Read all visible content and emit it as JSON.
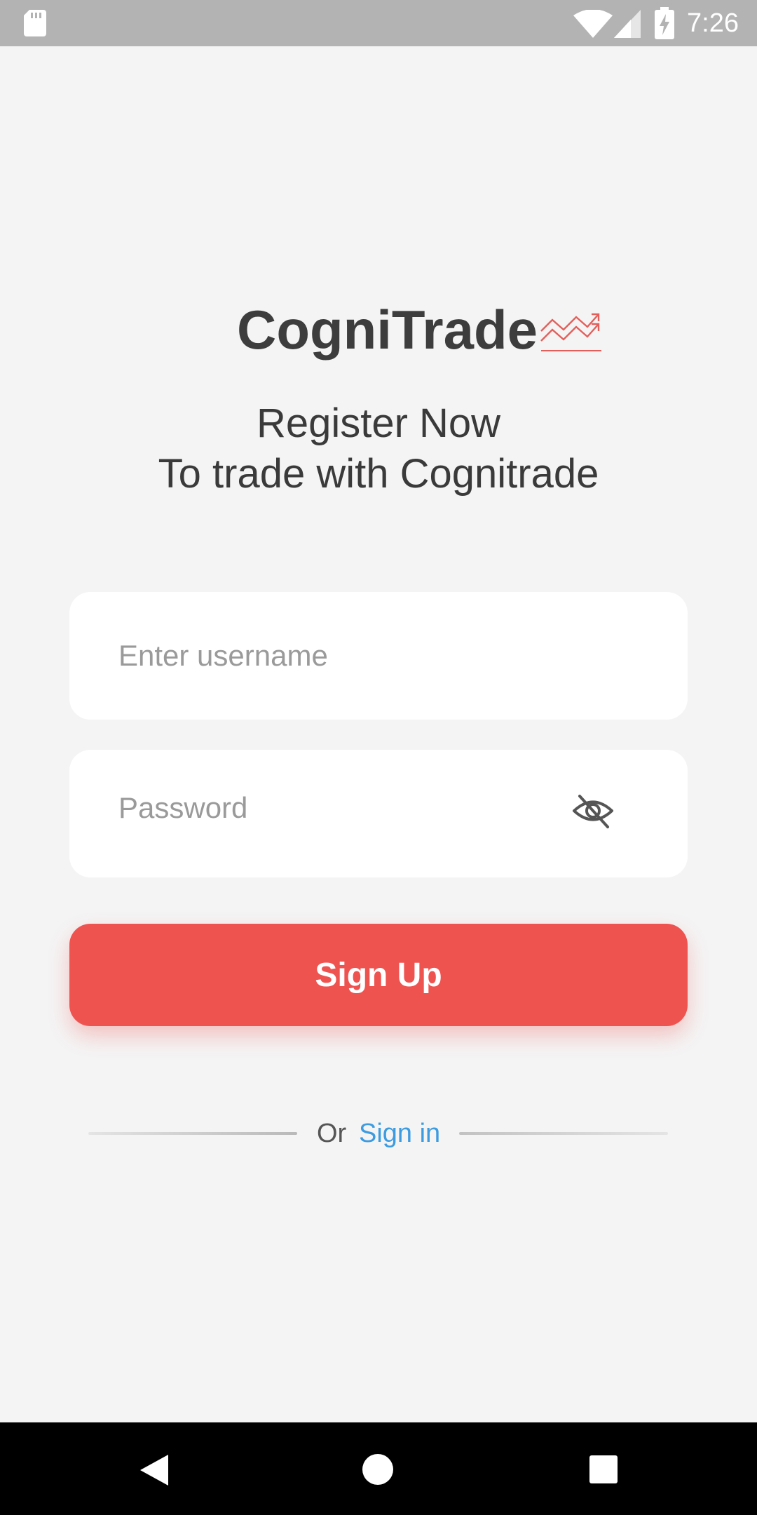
{
  "status_bar": {
    "time": "7:26",
    "icons": [
      "sd-card-icon",
      "wifi-icon",
      "signal-icon",
      "battery-charging-icon"
    ]
  },
  "brand": {
    "name": "CogniTrade",
    "icon": "trending-up-chart-icon",
    "accent_color": "#ef5350"
  },
  "tagline": {
    "line1": "Register Now",
    "line2": "To trade with Cognitrade"
  },
  "form": {
    "username_placeholder": "Enter username",
    "username_value": "",
    "password_placeholder": "Password",
    "password_value": "",
    "password_toggle_icon": "eye-off-icon",
    "submit_label": "Sign Up"
  },
  "alt_action": {
    "or_text": "Or",
    "signin_label": "Sign in",
    "link_color": "#3d9be0"
  },
  "nav_bar": {
    "icons": [
      "back-icon",
      "home-icon",
      "recents-icon"
    ]
  }
}
